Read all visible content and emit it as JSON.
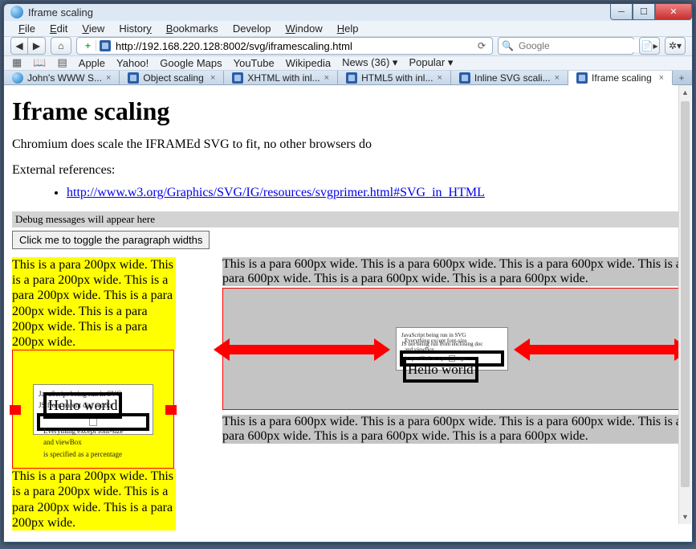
{
  "window": {
    "title": "Iframe scaling"
  },
  "menu": [
    "File",
    "Edit",
    "View",
    "History",
    "Bookmarks",
    "Develop",
    "Window",
    "Help"
  ],
  "url": "http://192.168.220.128:8002/svg/iframescaling.html",
  "search_placeholder": "Google",
  "bookmarks": [
    "Apple",
    "Yahoo!",
    "Google Maps",
    "YouTube",
    "Wikipedia",
    "News (36) ▾",
    "Popular ▾"
  ],
  "tabs": [
    {
      "label": "John's WWW S...",
      "fav": "globe"
    },
    {
      "label": "Object scaling",
      "fav": "sq"
    },
    {
      "label": "XHTML with inl...",
      "fav": "sq"
    },
    {
      "label": "HTML5 with inl...",
      "fav": "sq"
    },
    {
      "label": "Inline SVG scali...",
      "fav": "sq"
    },
    {
      "label": "Iframe scaling",
      "fav": "sq",
      "active": true
    }
  ],
  "page": {
    "heading": "Iframe scaling",
    "intro": "Chromium does scale the IFRAMEd SVG to fit, no other browsers do",
    "ext_ref_label": "External references:",
    "ext_link": "http://www.w3.org/Graphics/SVG/IG/resources/svgprimer.html#SVG_in_HTML",
    "debug": "Debug messages will appear here",
    "toggle_btn": "Click me to toggle the paragraph widths",
    "para200": "This is a para 200px wide. This is a para 200px wide. This is a para 200px wide. This is a para 200px wide. This is a para 200px wide. This is a para 200px wide.",
    "para200b": "This is a para 200px wide. This is a para 200px wide. This is a para 200px wide. This is a para 200px wide.",
    "para600": "This is a para 600px wide. This is a para 600px wide. This is a para 600px wide. This is a para 600px wide. This is a para 600px wide. This is a para 600px wide.",
    "svg_lines_small": [
      "JavaScript being run in SVG",
      "JS from parent doc works"
    ],
    "svg_lines_big": [
      "JavaScript being run in SVG",
      "JS not being run from enclosing doc"
    ],
    "svg_hello": "Hello world",
    "svg_foot": [
      "Everything except font-size",
      "and viewBox",
      "is specified as a percentage"
    ]
  }
}
